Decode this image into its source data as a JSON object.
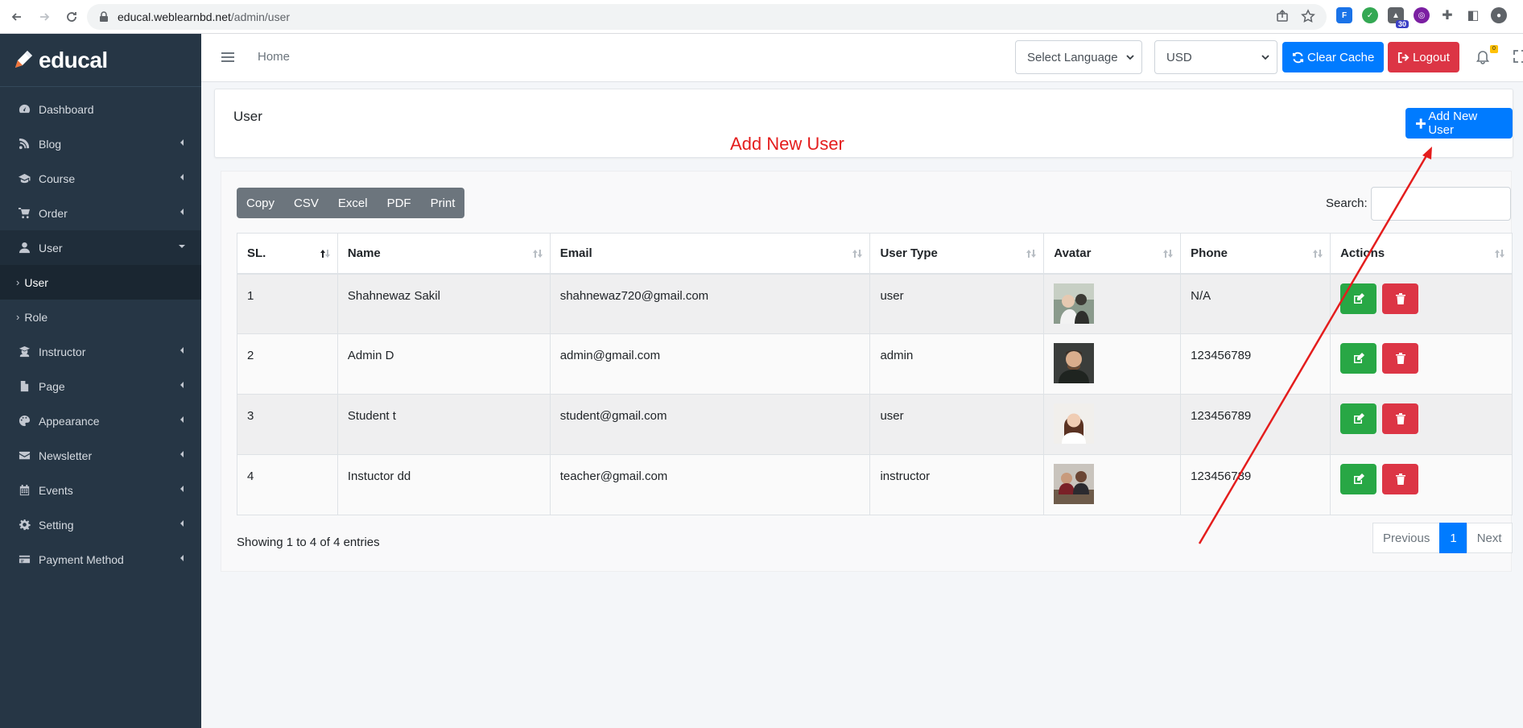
{
  "browser": {
    "url_host": "educal.weblearnbd.net",
    "url_path": "/admin/user",
    "ext_badge": "30"
  },
  "sidebar": {
    "brand": "educal",
    "items": [
      {
        "label": "Dashboard",
        "icon": "dashboard-icon",
        "has_children": false
      },
      {
        "label": "Blog",
        "icon": "blog-icon",
        "has_children": true
      },
      {
        "label": "Course",
        "icon": "graduation-cap-icon",
        "has_children": true
      },
      {
        "label": "Order",
        "icon": "cart-icon",
        "has_children": true
      },
      {
        "label": "User",
        "icon": "user-icon",
        "has_children": true,
        "open": true
      },
      {
        "label": "Instructor",
        "icon": "instructor-icon",
        "has_children": true
      },
      {
        "label": "Page",
        "icon": "page-icon",
        "has_children": true
      },
      {
        "label": "Appearance",
        "icon": "palette-icon",
        "has_children": true
      },
      {
        "label": "Newsletter",
        "icon": "envelope-icon",
        "has_children": true
      },
      {
        "label": "Events",
        "icon": "calendar-icon",
        "has_children": true
      },
      {
        "label": "Setting",
        "icon": "gear-icon",
        "has_children": true
      },
      {
        "label": "Payment Method",
        "icon": "credit-card-icon",
        "has_children": true
      }
    ],
    "user_submenu": [
      {
        "label": "User",
        "active": true
      },
      {
        "label": "Role",
        "active": false
      }
    ]
  },
  "topnav": {
    "home": "Home",
    "language_select": "Select Language",
    "currency_select": "USD",
    "clear_cache": "Clear Cache",
    "logout": "Logout",
    "bell_count": "0"
  },
  "header": {
    "title": "User",
    "add_button": "Add New User"
  },
  "annotation": {
    "label": "Add New User",
    "color": "#e41d1d"
  },
  "table": {
    "export_buttons": [
      "Copy",
      "CSV",
      "Excel",
      "PDF",
      "Print"
    ],
    "search_label": "Search:",
    "columns": [
      "SL.",
      "Name",
      "Email",
      "User Type",
      "Avatar",
      "Phone",
      "Actions"
    ],
    "rows": [
      {
        "sl": "1",
        "name": "Shahnewaz Sakil",
        "email": "shahnewaz720@gmail.com",
        "type": "user",
        "phone": "N/A"
      },
      {
        "sl": "2",
        "name": "Admin D",
        "email": "admin@gmail.com",
        "type": "admin",
        "phone": "123456789"
      },
      {
        "sl": "3",
        "name": "Student t",
        "email": "student@gmail.com",
        "type": "user",
        "phone": "123456789"
      },
      {
        "sl": "4",
        "name": "Instuctor dd",
        "email": "teacher@gmail.com",
        "type": "instructor",
        "phone": "123456789"
      }
    ],
    "info": "Showing 1 to 4 of 4 entries",
    "pagination": {
      "previous": "Previous",
      "page": "1",
      "next": "Next"
    }
  },
  "colors": {
    "sidebar_bg": "#263645",
    "primary": "#007bff",
    "danger": "#dc3545",
    "success": "#28a745",
    "export_bg": "#6c757d"
  }
}
